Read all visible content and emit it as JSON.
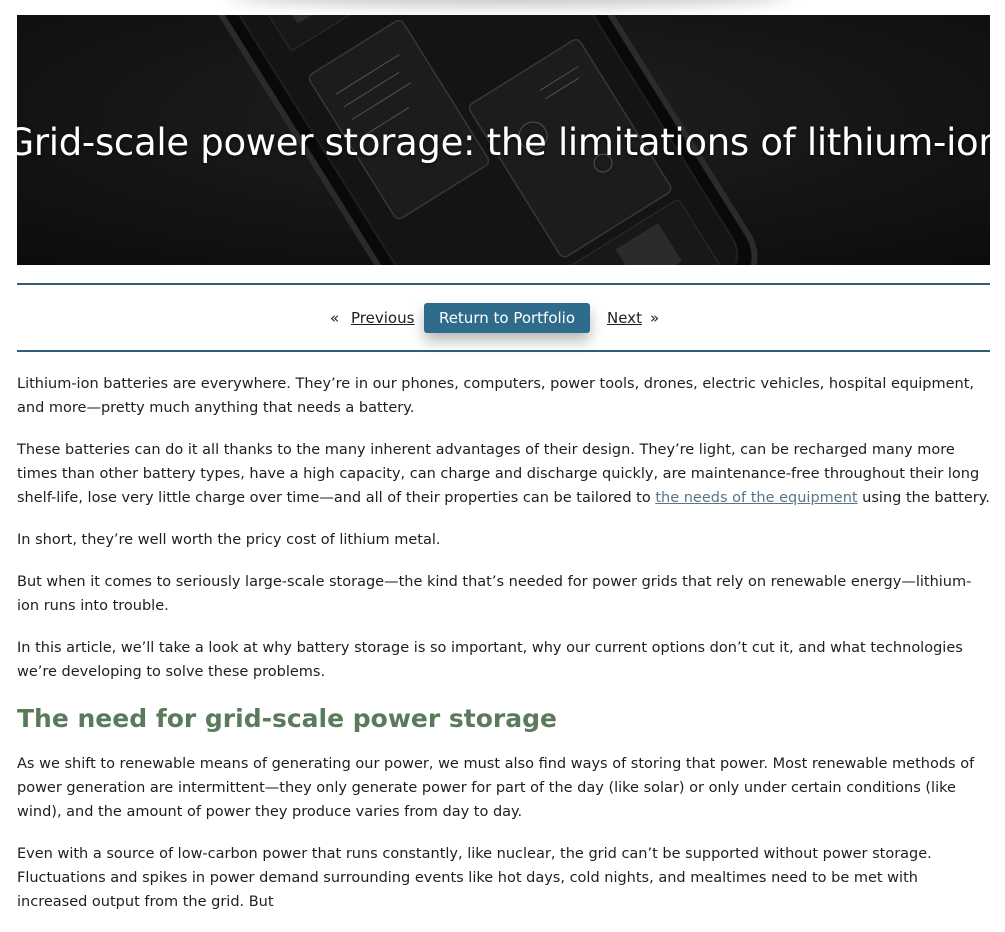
{
  "hero": {
    "title": "Grid-scale power storage: the limitations of lithium-ion",
    "image_description": "smartphone-internals-image"
  },
  "post_nav": {
    "prev_arrow": "«",
    "prev_label": "Previous",
    "return_label": "Return to Portfolio",
    "next_label": "Next",
    "next_arrow": "»"
  },
  "article": {
    "p1": "Lithium-ion batteries are everywhere. They’re in our phones, computers, power tools, drones, electric vehicles, hospital equipment, and more—pretty much anything that needs a battery.",
    "p2_before": "These batteries can do it all thanks to the many inherent advantages of their design. They’re light, can be recharged many more times than other battery types, have a high capacity, can charge and discharge quickly, are maintenance-free throughout their long shelf-life, lose very little charge over time—and all of their properties can be tailored to ",
    "p2_link": "the needs of the equipment",
    "p2_after": " using the battery.",
    "p3": "In short, they’re well worth the pricy cost of lithium metal.",
    "p4": "But when it comes to seriously large-scale storage—the kind that’s needed for power grids that rely on renewable energy—lithium-ion runs into trouble.",
    "p5": "In this article, we’ll take a look at why battery storage is so important, why our current options don’t cut it, and what technologies we’re developing to solve these problems.",
    "h2": "The need for grid-scale power storage",
    "p6": "As we shift to renewable means of generating our power, we must also find ways of storing that power. Most renewable methods of power generation are intermittent—they only generate power for part of the day (like solar) or only under certain conditions (like wind), and the amount of power they produce varies from day to day.",
    "p7": "Even with a source of low-carbon power that runs constantly, like nuclear, the grid can’t be supported without power storage. Fluctuations and spikes in power demand surrounding events like hot days, cold nights, and mealtimes need to be met with increased output from the grid. But"
  },
  "colors": {
    "accent": "#2f6b8a",
    "rule": "#2d5f7a",
    "heading": "#5a7a5c",
    "link": "#57758a"
  }
}
